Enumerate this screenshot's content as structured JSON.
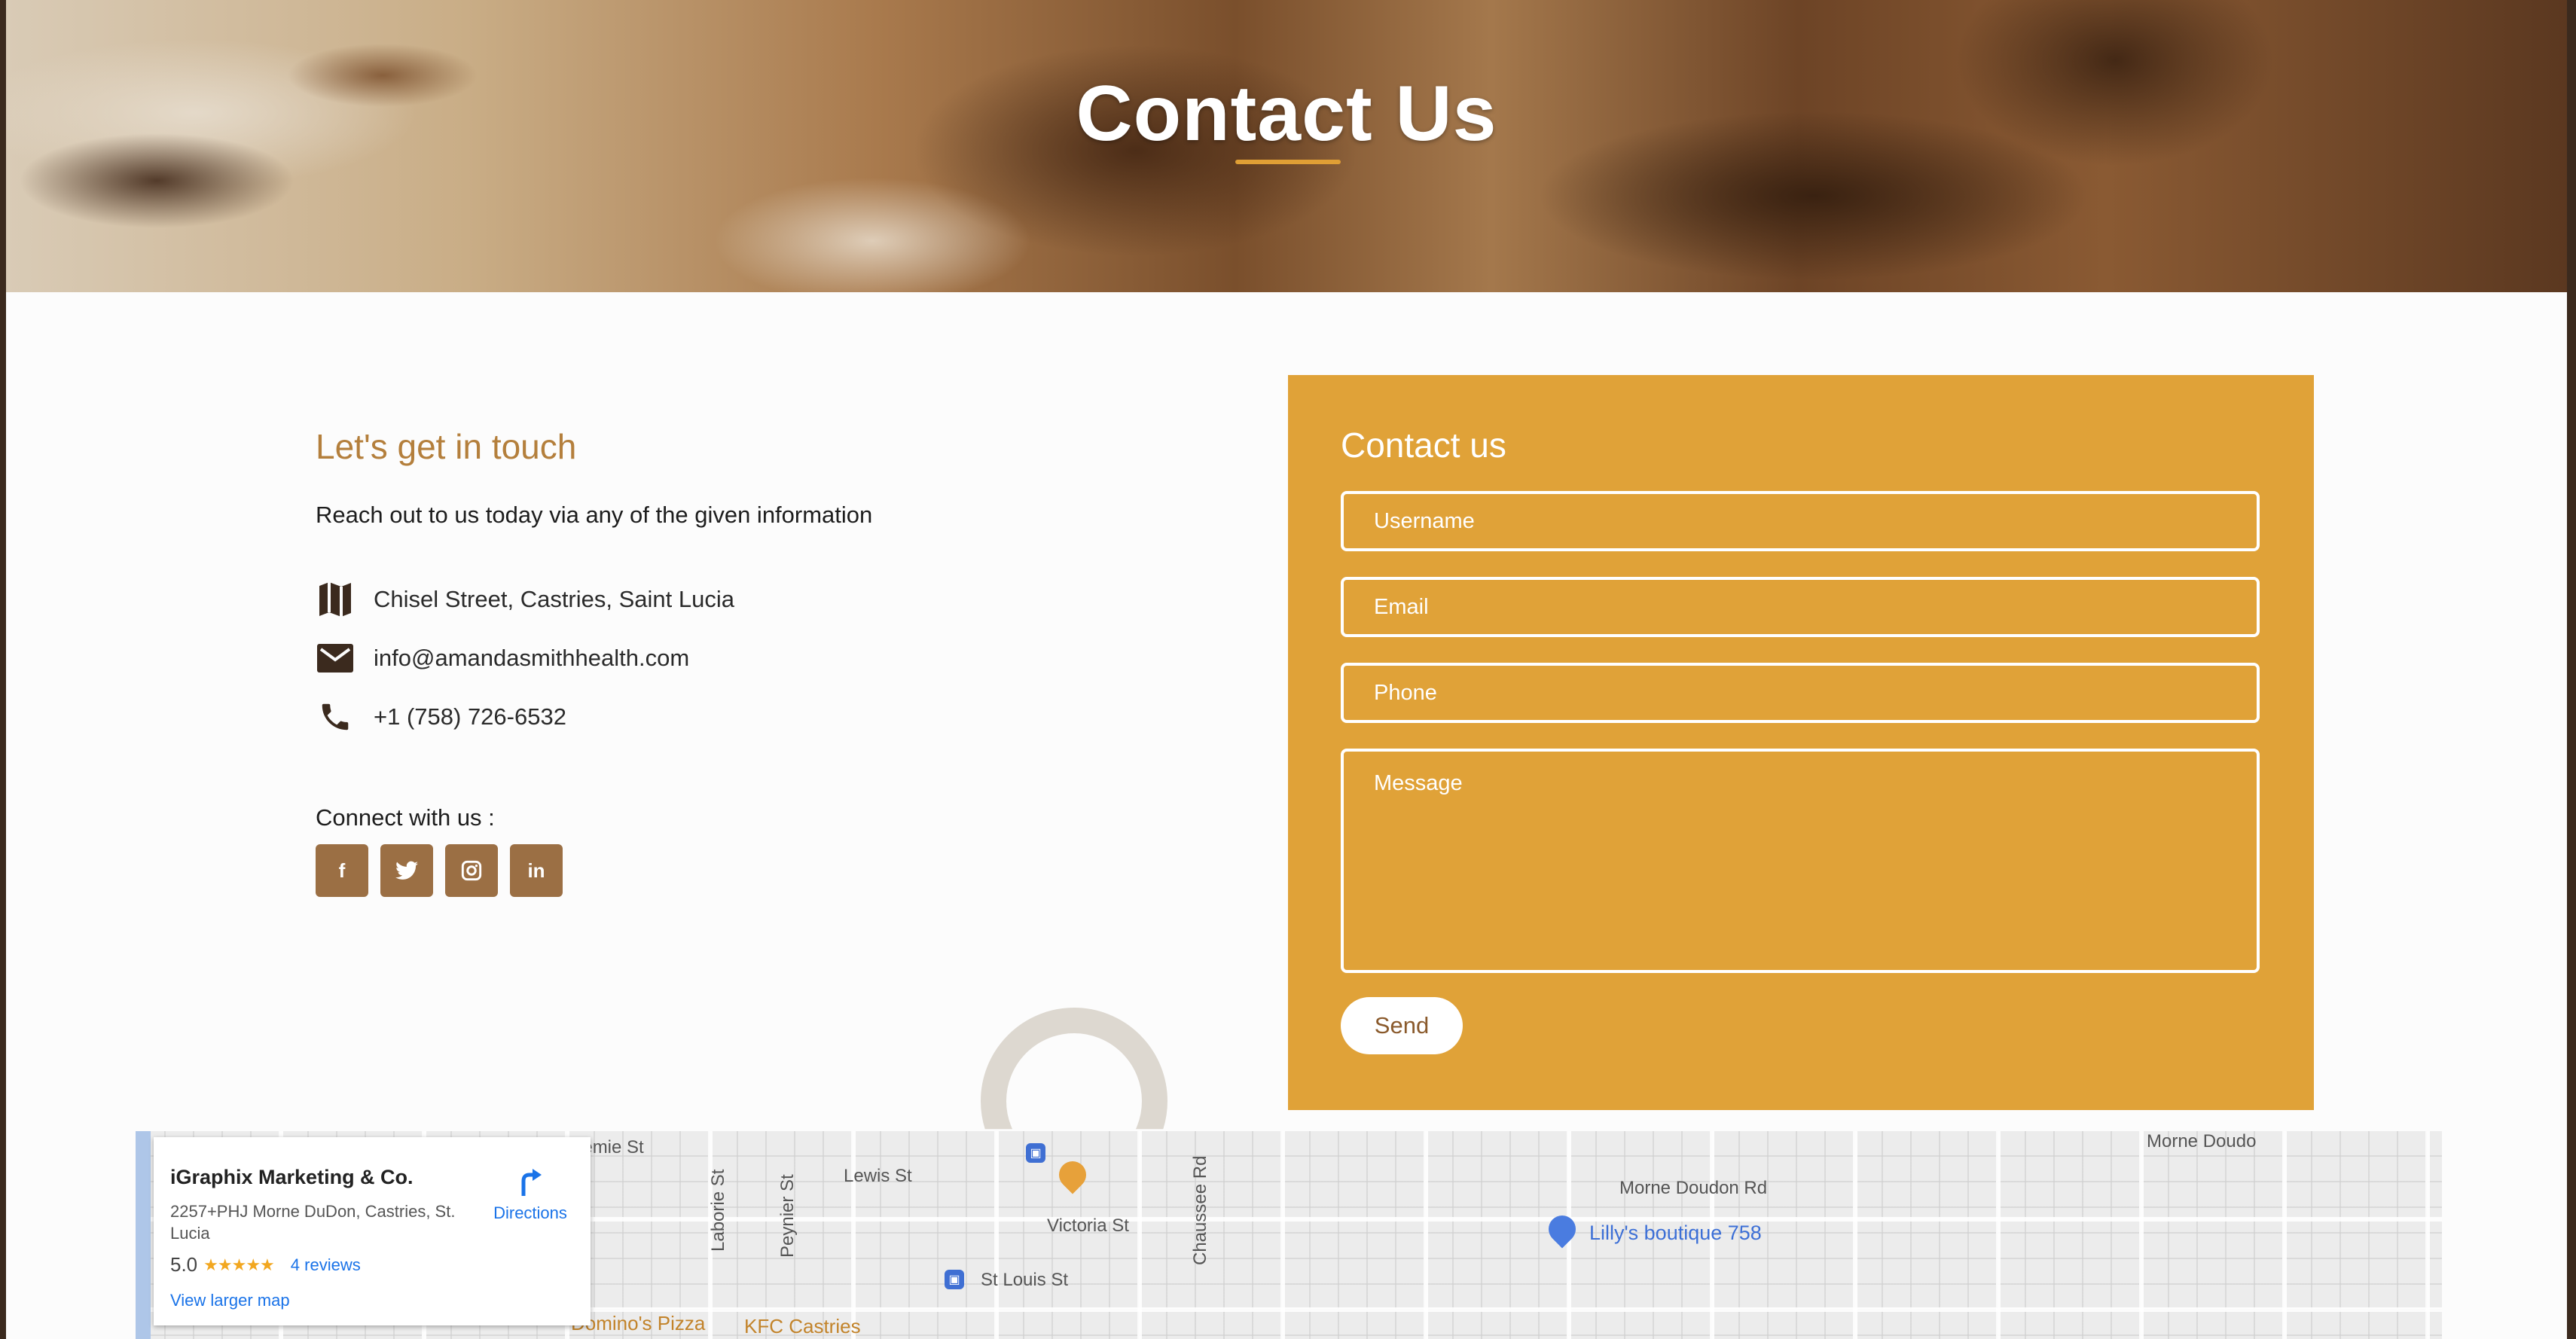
{
  "hero": {
    "title": "Contact Us"
  },
  "info": {
    "title": "Let's get in touch",
    "subtitle": "Reach out to us today via any of the given information",
    "address": "Chisel Street, Castries, Saint Lucia",
    "email": "info@amandasmithhealth.com",
    "phone": "+1 (758) 726-6532",
    "connect_label": "Connect with us :",
    "socials": [
      {
        "name": "facebook-icon",
        "glyph": "f"
      },
      {
        "name": "twitter-icon",
        "glyph": "t"
      },
      {
        "name": "instagram-icon",
        "glyph": "◎"
      },
      {
        "name": "linkedin-icon",
        "glyph": "in"
      }
    ]
  },
  "form": {
    "title": "Contact us",
    "username_placeholder": "Username",
    "email_placeholder": "Email",
    "phone_placeholder": "Phone",
    "message_placeholder": "Message",
    "send_label": "Send"
  },
  "map": {
    "place_name": "iGraphix Marketing & Co.",
    "address": "2257+PHJ Morne DuDon, Castries, St. Lucia",
    "rating": "5.0",
    "stars": "★★★★★",
    "reviews": "4 reviews",
    "directions_label": "Directions",
    "larger_map_label": "View larger map",
    "labels": {
      "jeremie": "Jeremie St",
      "lewis": "Lewis St",
      "laborie": "Laborie St",
      "peynier": "Peynier St",
      "victoria": "Victoria St",
      "stlouis": "St Louis St",
      "chaussee": "Chaussee Rd",
      "morne_doudon": "Morne Doudon Rd",
      "morne_doudon2": "Morne Doudo",
      "lillys": "Lilly's boutique 758",
      "dominos": "Domino's Pizza",
      "kfc": "KFC Castries"
    }
  },
  "colors": {
    "accent": "#e0a238",
    "brown": "#9b6f44",
    "heading": "#b47f3c"
  }
}
